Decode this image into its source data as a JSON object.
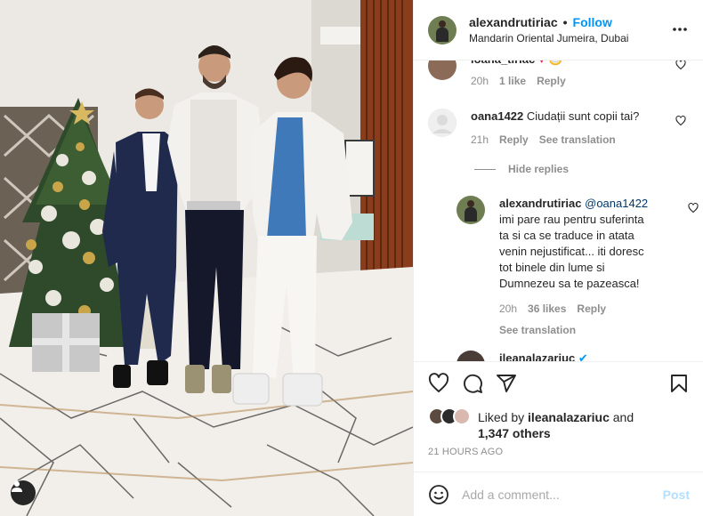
{
  "post": {
    "username": "alexandrutiriac",
    "separator": "•",
    "follow_label": "Follow",
    "location": "Mandarin Oriental Jumeira, Dubai",
    "more_icon": "more-horizontal-icon"
  },
  "comments": [
    {
      "username": "ioana_tiriac",
      "text": "",
      "time": "20h",
      "likes": "1 like",
      "reply_label": "Reply"
    },
    {
      "username": "oana1422",
      "text": "Ciudații sunt copii tai?",
      "time": "21h",
      "reply_label": "Reply",
      "translation_label": "See translation",
      "hide_replies_label": "Hide replies"
    },
    {
      "username": "alexandrutiriac",
      "mention": "@oana1422",
      "text": "imi pare rau pentru suferinta ta si ca se traduce in atata venin nejustificat... iti doresc tot binele din lume si Dumnezeu sa te pazeasca!",
      "time": "20h",
      "likes": "36 likes",
      "reply_label": "Reply",
      "translation_label": "See translation"
    },
    {
      "username": "ileanalazariuc"
    }
  ],
  "actions": {
    "like_icon": "heart-icon",
    "comment_icon": "comment-icon",
    "share_icon": "share-icon",
    "save_icon": "bookmark-icon"
  },
  "likes": {
    "prefix": "Liked by",
    "user": "ileanalazariuc",
    "and": "and",
    "others": "1,347 others"
  },
  "timestamp": "21 HOURS AGO",
  "add_comment": {
    "placeholder": "Add a comment...",
    "post_label": "Post",
    "emoji_icon": "smiley-icon"
  },
  "colors": {
    "accent": "#0095f6",
    "post_disabled": "#b2dffc",
    "muted": "#8e8e8e",
    "text": "#262626"
  }
}
